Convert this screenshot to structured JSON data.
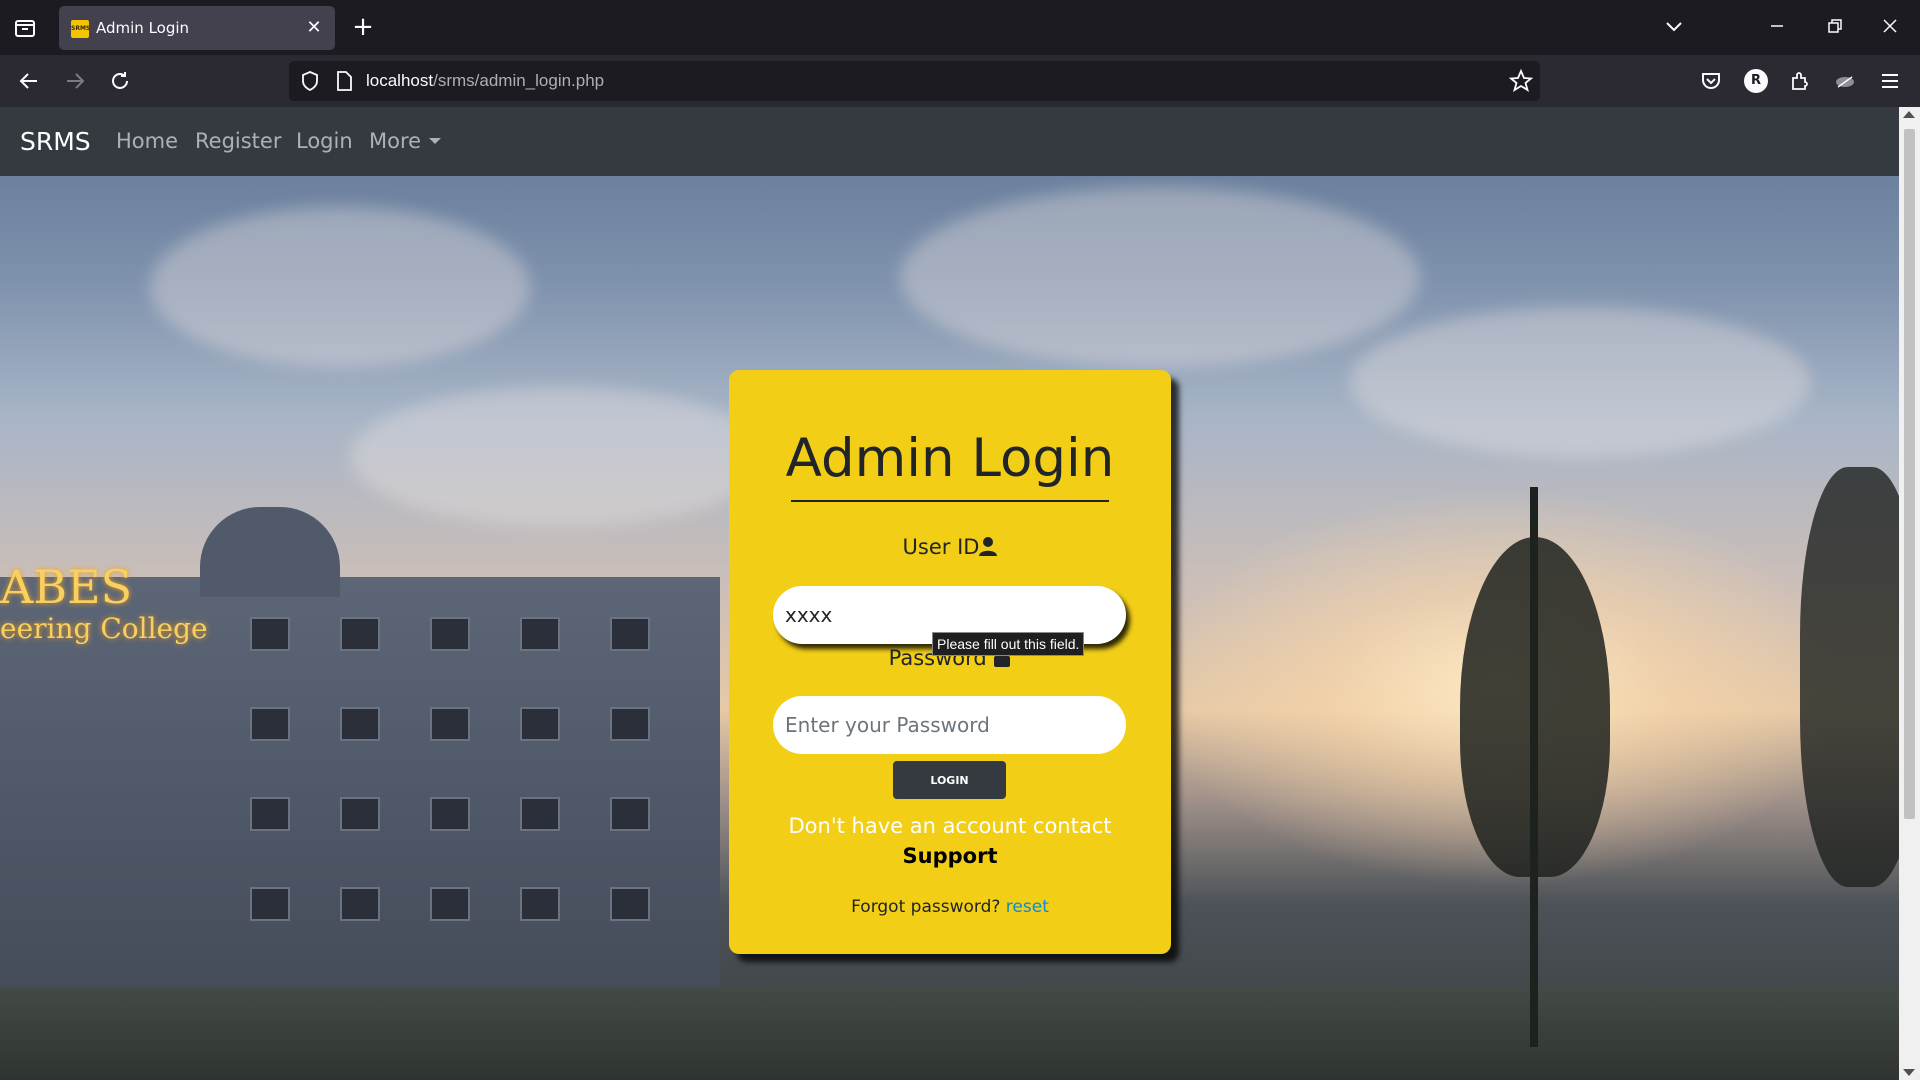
{
  "browser": {
    "tab_title": "Admin Login",
    "favicon_text": "SRMS",
    "url_host": "localhost",
    "url_path": "/srms/admin_login.php",
    "account_initial": "R"
  },
  "site": {
    "brand": "SRMS",
    "nav": [
      {
        "label": "Home"
      },
      {
        "label": "Register"
      },
      {
        "label": "Login"
      },
      {
        "label": "More"
      }
    ]
  },
  "background": {
    "sign_line1": "ABES",
    "sign_line2": "eering College"
  },
  "login": {
    "title": "Admin Login",
    "user_label": "User ID",
    "user_value": "xxxx",
    "password_label": "Password",
    "password_placeholder": "Enter your Password",
    "login_button": "LOGIN",
    "no_account": "Don't have an account contact",
    "support": "Support",
    "forgot_text": "Forgot password? ",
    "reset_link": "reset"
  },
  "tooltip": "Please fill out this field.",
  "colors": {
    "card": "#f2ce17",
    "navbar": "#343a40",
    "link": "#0d8bd6"
  }
}
